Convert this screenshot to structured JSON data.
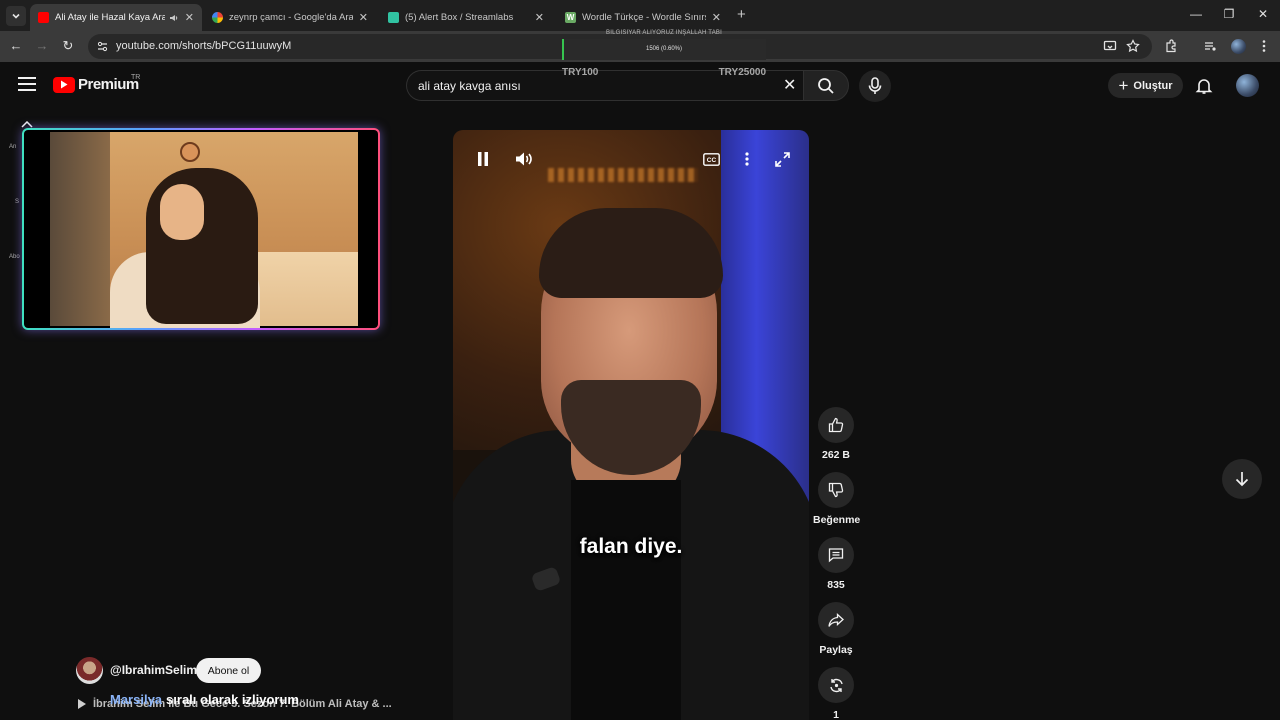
{
  "browser": {
    "tabs": [
      {
        "title": "Ali Atay ile Hazal Kaya Arası",
        "active": true,
        "favicon_color": "#ff0000",
        "audio": true
      },
      {
        "title": "zeynrp çamcı - Google'da Ara",
        "active": false,
        "favicon_color": "#4285f4"
      },
      {
        "title": "(5) Alert Box / Streamlabs",
        "active": false,
        "favicon_color": "#31c3a2"
      },
      {
        "title": "Wordle Türkçe - Wordle Sınırsız",
        "active": false,
        "favicon_color": "#6aaa64",
        "favicon_letter": "W"
      }
    ],
    "url": "youtube.com/shorts/bPCG11uuwyM"
  },
  "donation_goal": {
    "title": "BILGISIYAR ALIYORUZ INŞALLAH TABI",
    "progress_text": "1506 (0.60%)",
    "progress_fraction": 0.006,
    "min_label": "TRY100",
    "max_label": "TRY25000"
  },
  "yt_header": {
    "logo_text": "Premium",
    "country": "TR",
    "search_query": "ali atay kavga anısı",
    "create_label": "Oluştur"
  },
  "sidebar_fragments": [
    "An",
    "S",
    "Abo"
  ],
  "player": {
    "caption": "falan diye."
  },
  "actions": {
    "like_count": "262 B",
    "dislike_label": "Beğenme",
    "comment_count": "835",
    "share_label": "Paylaş",
    "remix_count": "1"
  },
  "channel": {
    "handle": "@IbrahimSelim",
    "subscribe_label": "Abone ol",
    "playlist_title": "İbrahim Selim ile Bu Gece 3. Sezon 7. Bölüm Ali Atay & ..."
  },
  "chat_overlay": {
    "user": "Marsilya",
    "message": "sıralı olarak izliyorum"
  }
}
